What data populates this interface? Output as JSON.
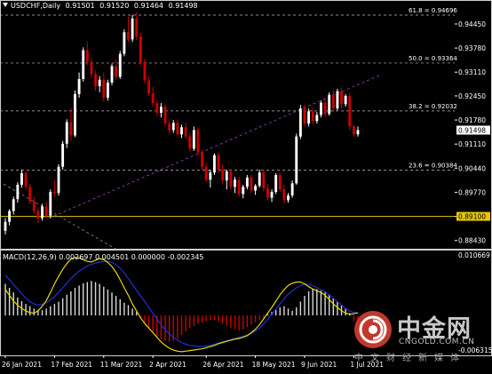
{
  "chart": {
    "symbol": "USDCHF,Daily",
    "open": "0.91501",
    "high": "0.91520",
    "low": "0.91464",
    "close": "0.91498",
    "current_price_tag": "0.91498",
    "horizontal_level_tag": "0.89100"
  },
  "fibonacci": [
    {
      "label": "61.8 = 0.94696",
      "price": 0.94696
    },
    {
      "label": "50.0 = 0.93364",
      "price": 0.93364
    },
    {
      "label": "38.2 = 0.92032",
      "price": 0.92032
    },
    {
      "label": "23.6 = 0.90384",
      "price": 0.90384
    }
  ],
  "price_axis": [
    "0.94450",
    "0.93780",
    "0.93110",
    "0.92450",
    "0.91780",
    "0.91110",
    "0.90440",
    "0.89770",
    "0.89100",
    "0.88430"
  ],
  "macd": {
    "label": "MACD(12,26,9) 0.002697 0.004501 0.000000 -0.002345",
    "axis_top": "0.010669",
    "axis_bottom": "-0.006315"
  },
  "date_axis": [
    "26 Jan 2021",
    "17 Feb 2021",
    "11 Mar 2021",
    "2 Apr 2021",
    "26 Apr 2021",
    "18 May 2021",
    "9 Jun 2021",
    "1 Jul 2021"
  ],
  "watermark": {
    "title": "中金网",
    "domain": "CNGOLD.COM.CN",
    "subtitle": "中文财经新媒体"
  },
  "colors": {
    "bull": "#ffffff",
    "bear": "#cc0000",
    "level": "#e6c700",
    "trend": "#a040c0",
    "macd_main": "#e6d800",
    "macd_signal": "#2030d0"
  },
  "candles": [
    [
      0.887,
      0.8905,
      0.886,
      0.8895
    ],
    [
      0.8895,
      0.893,
      0.8885,
      0.8925
    ],
    [
      0.8925,
      0.8965,
      0.8915,
      0.8958
    ],
    [
      0.8958,
      0.9005,
      0.8948,
      0.8998
    ],
    [
      0.8998,
      0.904,
      0.899,
      0.903
    ],
    [
      0.903,
      0.9035,
      0.8985,
      0.8992
    ],
    [
      0.8992,
      0.9,
      0.8945,
      0.8952
    ],
    [
      0.8952,
      0.8965,
      0.8918,
      0.8925
    ],
    [
      0.8925,
      0.8935,
      0.8892,
      0.8905
    ],
    [
      0.8905,
      0.8945,
      0.8898,
      0.8938
    ],
    [
      0.8938,
      0.895,
      0.8905,
      0.8912
    ],
    [
      0.8912,
      0.8985,
      0.8905,
      0.8978
    ],
    [
      0.8978,
      0.901,
      0.8965,
      0.8975
    ],
    [
      0.8975,
      0.9055,
      0.8968,
      0.9048
    ],
    [
      0.9048,
      0.912,
      0.904,
      0.9112
    ],
    [
      0.9112,
      0.918,
      0.91,
      0.9172
    ],
    [
      0.9172,
      0.921,
      0.912,
      0.9135
    ],
    [
      0.9135,
      0.926,
      0.913,
      0.925
    ],
    [
      0.925,
      0.931,
      0.924,
      0.9292
    ],
    [
      0.9292,
      0.938,
      0.9285,
      0.9372
    ],
    [
      0.9372,
      0.9395,
      0.933,
      0.934
    ],
    [
      0.934,
      0.935,
      0.9295,
      0.9305
    ],
    [
      0.9305,
      0.9315,
      0.926,
      0.9272
    ],
    [
      0.9272,
      0.93,
      0.9255,
      0.929
    ],
    [
      0.929,
      0.931,
      0.923,
      0.924
    ],
    [
      0.924,
      0.929,
      0.9232,
      0.9282
    ],
    [
      0.9282,
      0.9335,
      0.9275,
      0.9328
    ],
    [
      0.9328,
      0.9345,
      0.929,
      0.9298
    ],
    [
      0.9298,
      0.937,
      0.9292,
      0.9362
    ],
    [
      0.9362,
      0.943,
      0.9355,
      0.9422
    ],
    [
      0.9422,
      0.9465,
      0.9395,
      0.9402
    ],
    [
      0.9402,
      0.947,
      0.9395,
      0.946
    ],
    [
      0.946,
      0.9478,
      0.94,
      0.941
    ],
    [
      0.941,
      0.942,
      0.933,
      0.934
    ],
    [
      0.934,
      0.9348,
      0.928,
      0.9288
    ],
    [
      0.9288,
      0.93,
      0.9245,
      0.9252
    ],
    [
      0.9252,
      0.927,
      0.9215,
      0.9225
    ],
    [
      0.9225,
      0.9235,
      0.919,
      0.9198
    ],
    [
      0.9198,
      0.9225,
      0.9185,
      0.9215
    ],
    [
      0.9215,
      0.9222,
      0.916,
      0.9168
    ],
    [
      0.9168,
      0.918,
      0.914,
      0.915
    ],
    [
      0.915,
      0.9178,
      0.9142,
      0.917
    ],
    [
      0.917,
      0.918,
      0.913,
      0.9138
    ],
    [
      0.9138,
      0.9165,
      0.9128,
      0.9158
    ],
    [
      0.9158,
      0.917,
      0.9125,
      0.9132
    ],
    [
      0.9132,
      0.9145,
      0.909,
      0.9098
    ],
    [
      0.9098,
      0.916,
      0.9092,
      0.915
    ],
    [
      0.915,
      0.9158,
      0.908,
      0.9088
    ],
    [
      0.9088,
      0.9095,
      0.904,
      0.9048
    ],
    [
      0.9048,
      0.906,
      0.9005,
      0.9012
    ],
    [
      0.9012,
      0.904,
      0.899,
      0.9032
    ],
    [
      0.9032,
      0.9085,
      0.9025,
      0.908
    ],
    [
      0.908,
      0.9088,
      0.903,
      0.904
    ],
    [
      0.904,
      0.9055,
      0.9,
      0.901
    ],
    [
      0.901,
      0.904,
      0.8985,
      0.9035
    ],
    [
      0.9035,
      0.9042,
      0.8985,
      0.8992
    ],
    [
      0.8992,
      0.902,
      0.8975,
      0.9012
    ],
    [
      0.9012,
      0.902,
      0.8965,
      0.8972
    ],
    [
      0.8972,
      0.8998,
      0.896,
      0.8992
    ],
    [
      0.8992,
      0.9025,
      0.8985,
      0.9018
    ],
    [
      0.9018,
      0.9025,
      0.8975,
      0.8982
    ],
    [
      0.8982,
      0.9,
      0.897,
      0.8995
    ],
    [
      0.8995,
      0.904,
      0.899,
      0.9032
    ],
    [
      0.9032,
      0.904,
      0.898,
      0.8988
    ],
    [
      0.8988,
      0.9,
      0.8955,
      0.8962
    ],
    [
      0.8962,
      0.8985,
      0.895,
      0.8978
    ],
    [
      0.8978,
      0.903,
      0.8972,
      0.9025
    ],
    [
      0.9025,
      0.9032,
      0.8978,
      0.8985
    ],
    [
      0.8985,
      0.8998,
      0.8945,
      0.8955
    ],
    [
      0.8955,
      0.8975,
      0.8948,
      0.8968
    ],
    [
      0.8968,
      0.901,
      0.8962,
      0.9002
    ],
    [
      0.9002,
      0.914,
      0.8998,
      0.9132
    ],
    [
      0.9132,
      0.922,
      0.9125,
      0.921
    ],
    [
      0.921,
      0.922,
      0.916,
      0.9168
    ],
    [
      0.9168,
      0.921,
      0.916,
      0.9202
    ],
    [
      0.9202,
      0.9212,
      0.9165,
      0.9175
    ],
    [
      0.9175,
      0.92,
      0.9168,
      0.9192
    ],
    [
      0.9192,
      0.9232,
      0.9185,
      0.9226
    ],
    [
      0.9226,
      0.924,
      0.9188,
      0.9195
    ],
    [
      0.9195,
      0.9255,
      0.919,
      0.9248
    ],
    [
      0.9248,
      0.9262,
      0.92,
      0.921
    ],
    [
      0.921,
      0.9265,
      0.9205,
      0.9258
    ],
    [
      0.9258,
      0.9268,
      0.921,
      0.9222
    ],
    [
      0.9222,
      0.925,
      0.9215,
      0.9245
    ],
    [
      0.9245,
      0.9252,
      0.915,
      0.916
    ],
    [
      0.916,
      0.9165,
      0.9132,
      0.9138
    ],
    [
      0.9138,
      0.916,
      0.9132,
      0.915
    ]
  ],
  "macd_hist": [
    0.0055,
    0.0048,
    0.004,
    0.0031,
    0.0025,
    0.002,
    0.0016,
    0.0012,
    0.001,
    0.0009,
    0.0012,
    0.0016,
    0.002,
    0.0024,
    0.003,
    0.0036,
    0.0042,
    0.0048,
    0.0052,
    0.0056,
    0.0058,
    0.006,
    0.0058,
    0.0055,
    0.005,
    0.0045,
    0.004,
    0.0034,
    0.0028,
    0.0022,
    0.0018,
    0.0012,
    0.0006,
    -0.0006,
    -0.0014,
    -0.0022,
    -0.003,
    -0.0036,
    -0.004,
    -0.0044,
    -0.0046,
    -0.0044,
    -0.004,
    -0.0034,
    -0.0028,
    -0.0022,
    -0.0018,
    -0.0014,
    -0.0012,
    -0.001,
    -0.0008,
    -0.0008,
    -0.001,
    -0.0014,
    -0.0018,
    -0.0022,
    -0.0024,
    -0.0026,
    -0.0024,
    -0.002,
    -0.0016,
    -0.0012,
    -0.0008,
    -0.0004,
    0.0002,
    0.0006,
    0.001,
    0.0014,
    0.0016,
    0.0012,
    0.0008,
    0.0014,
    0.0024,
    0.0034,
    0.0042,
    0.0046,
    0.0046,
    0.0043,
    0.004,
    0.0036,
    0.003,
    0.0024,
    0.0018,
    0.0012,
    0.0004,
    -0.001,
    -0.002
  ],
  "macd_main": [
    0.0045,
    0.0035,
    0.0025,
    0.0018,
    0.0012,
    0.0008,
    0.0005,
    0.0004,
    0.0008,
    0.0016,
    0.0026,
    0.004,
    0.0055,
    0.0068,
    0.008,
    0.009,
    0.0098,
    0.0101,
    0.01,
    0.0097,
    0.0094,
    0.0093,
    0.0096,
    0.0099,
    0.0097,
    0.0092,
    0.0085,
    0.0075,
    0.0062,
    0.0048,
    0.0035,
    0.002,
    0.0008,
    -0.0004,
    -0.0014,
    -0.0022,
    -0.003,
    -0.0038,
    -0.0046,
    -0.0052,
    -0.0057,
    -0.006,
    -0.0062,
    -0.0063,
    -0.0062,
    -0.0061,
    -0.006,
    -0.0059,
    -0.0058,
    -0.0056,
    -0.0054,
    -0.0052,
    -0.0049,
    -0.0047,
    -0.0045,
    -0.0043,
    -0.0041,
    -0.004,
    -0.0038,
    -0.0035,
    -0.003,
    -0.0024,
    -0.0016,
    -0.0006,
    0.0004,
    0.0014,
    0.0025,
    0.0036,
    0.0045,
    0.0052,
    0.0056,
    0.0058,
    0.0058,
    0.0055,
    0.005,
    0.0046,
    0.0043,
    0.004,
    0.0035,
    0.0028,
    0.002,
    0.0014,
    0.0008,
    0.0004,
    0.0002,
    0.0003,
    0.0005
  ],
  "macd_signal": [
    0.007,
    0.0062,
    0.0054,
    0.0046,
    0.0038,
    0.003,
    0.0024,
    0.002,
    0.0018,
    0.0019,
    0.0022,
    0.0027,
    0.0033,
    0.004,
    0.0048,
    0.0056,
    0.0064,
    0.0071,
    0.0077,
    0.0082,
    0.0086,
    0.0089,
    0.0091,
    0.0093,
    0.0094,
    0.0094,
    0.0092,
    0.0088,
    0.0082,
    0.0074,
    0.0064,
    0.0054,
    0.0044,
    0.0034,
    0.0024,
    0.0014,
    0.0004,
    -0.0006,
    -0.0016,
    -0.0025,
    -0.0032,
    -0.0038,
    -0.0043,
    -0.0047,
    -0.005,
    -0.0052,
    -0.0053,
    -0.0054,
    -0.0054,
    -0.0053,
    -0.0052,
    -0.005,
    -0.0048,
    -0.0046,
    -0.0044,
    -0.0042,
    -0.004,
    -0.0038,
    -0.0036,
    -0.0034,
    -0.0031,
    -0.0027,
    -0.0022,
    -0.0015,
    -0.0007,
    0.0002,
    0.0011,
    0.002,
    0.0029,
    0.0037,
    0.0043,
    0.0048,
    0.0052,
    0.0054,
    0.0054,
    0.0052,
    0.0049,
    0.0045,
    0.0041,
    0.0036,
    0.003,
    0.0024,
    0.0018,
    0.0012,
    0.0008,
    0.0005,
    0.0004
  ]
}
